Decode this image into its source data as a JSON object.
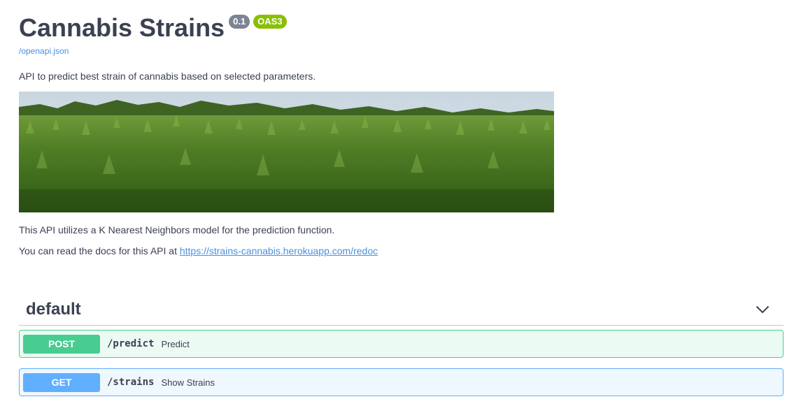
{
  "info": {
    "title": "Cannabis Strains",
    "version_badge": "0.1",
    "oas_badge": "OAS3",
    "spec_link": "/openapi.json",
    "description_1": "API to predict best strain of cannabis based on selected parameters.",
    "description_2": "This API utilizes a K Nearest Neighbors model for the prediction function.",
    "description_3_prefix": "You can read the docs for this API at ",
    "docs_link": "https://strains-cannabis.herokuapp.com/redoc"
  },
  "tag": {
    "name": "default",
    "chevron_icon": "chevron-down-icon"
  },
  "operations": [
    {
      "method": "POST",
      "path": "/predict",
      "summary": "Predict",
      "color": "#49cc90"
    },
    {
      "method": "GET",
      "path": "/strains",
      "summary": "Show Strains",
      "color": "#61affe"
    }
  ],
  "colors": {
    "text": "#3b4151",
    "link": "#4990e2",
    "version_badge": "#7d8492",
    "oas_badge": "#89bf04"
  }
}
